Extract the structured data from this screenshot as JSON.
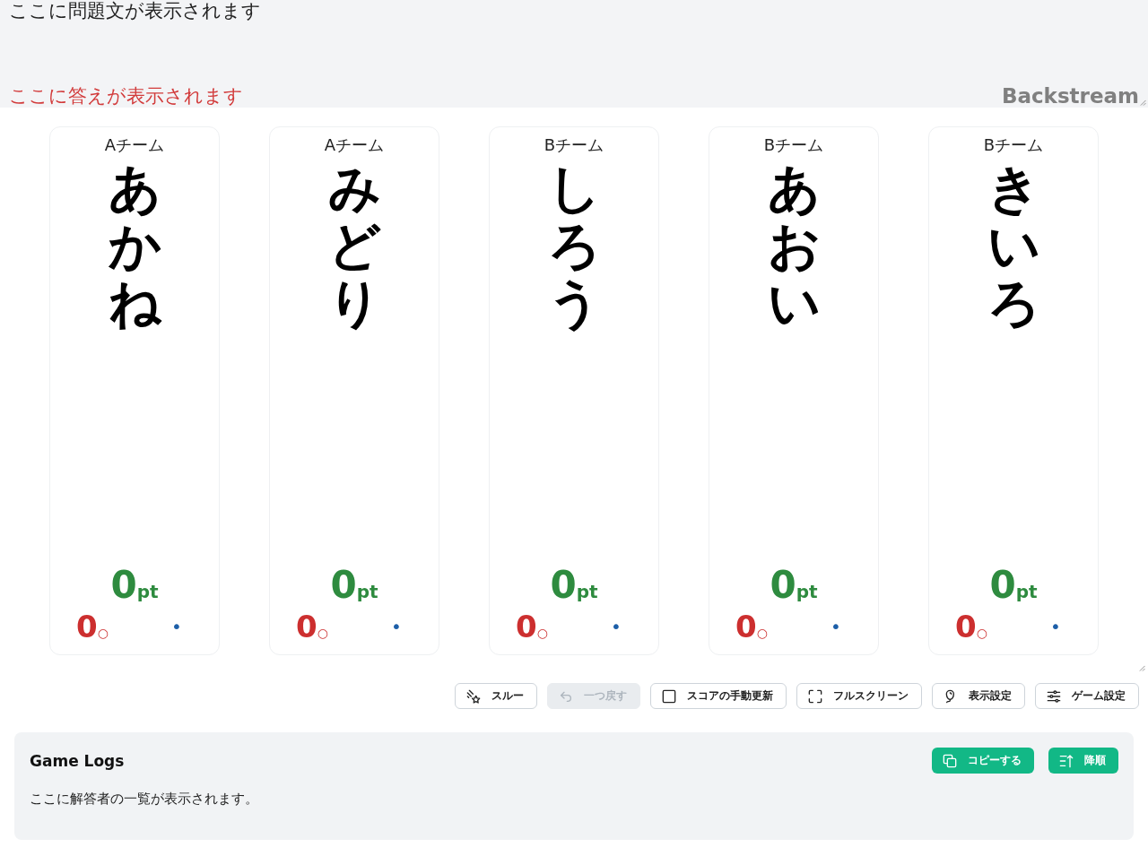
{
  "question_panel": {
    "question": "ここに問題文が表示されます",
    "answer": "ここに答えが表示されます",
    "brand": "Backstream"
  },
  "players": [
    {
      "team": "Aチーム",
      "name": "あかね",
      "score": "0",
      "score_unit": "pt",
      "correct": "0",
      "correct_mark": "○",
      "wrong_mark": "•"
    },
    {
      "team": "Aチーム",
      "name": "みどり",
      "score": "0",
      "score_unit": "pt",
      "correct": "0",
      "correct_mark": "○",
      "wrong_mark": "•"
    },
    {
      "team": "Bチーム",
      "name": "しろう",
      "score": "0",
      "score_unit": "pt",
      "correct": "0",
      "correct_mark": "○",
      "wrong_mark": "•"
    },
    {
      "team": "Bチーム",
      "name": "あおい",
      "score": "0",
      "score_unit": "pt",
      "correct": "0",
      "correct_mark": "○",
      "wrong_mark": "•"
    },
    {
      "team": "Bチーム",
      "name": "きいろ",
      "score": "0",
      "score_unit": "pt",
      "correct": "0",
      "correct_mark": "○",
      "wrong_mark": "•"
    }
  ],
  "toolbar": [
    {
      "kind": "pass",
      "label": "スルー",
      "disabled": false
    },
    {
      "kind": "undo",
      "label": "一つ戻す",
      "disabled": true
    },
    {
      "kind": "toggle",
      "label": "スコアの手動更新",
      "disabled": false,
      "checked": false
    },
    {
      "kind": "fullscreen",
      "label": "フルスクリーン",
      "disabled": false
    },
    {
      "kind": "display",
      "label": "表示設定",
      "disabled": false
    },
    {
      "kind": "settings",
      "label": "ゲーム設定",
      "disabled": false
    }
  ],
  "game_logs": {
    "title": "Game Logs",
    "buttons": [
      {
        "kind": "copy",
        "label": "コピーする"
      },
      {
        "kind": "sort",
        "label": "降順"
      }
    ],
    "message": "ここに解答者の一覧が表示されます。"
  }
}
